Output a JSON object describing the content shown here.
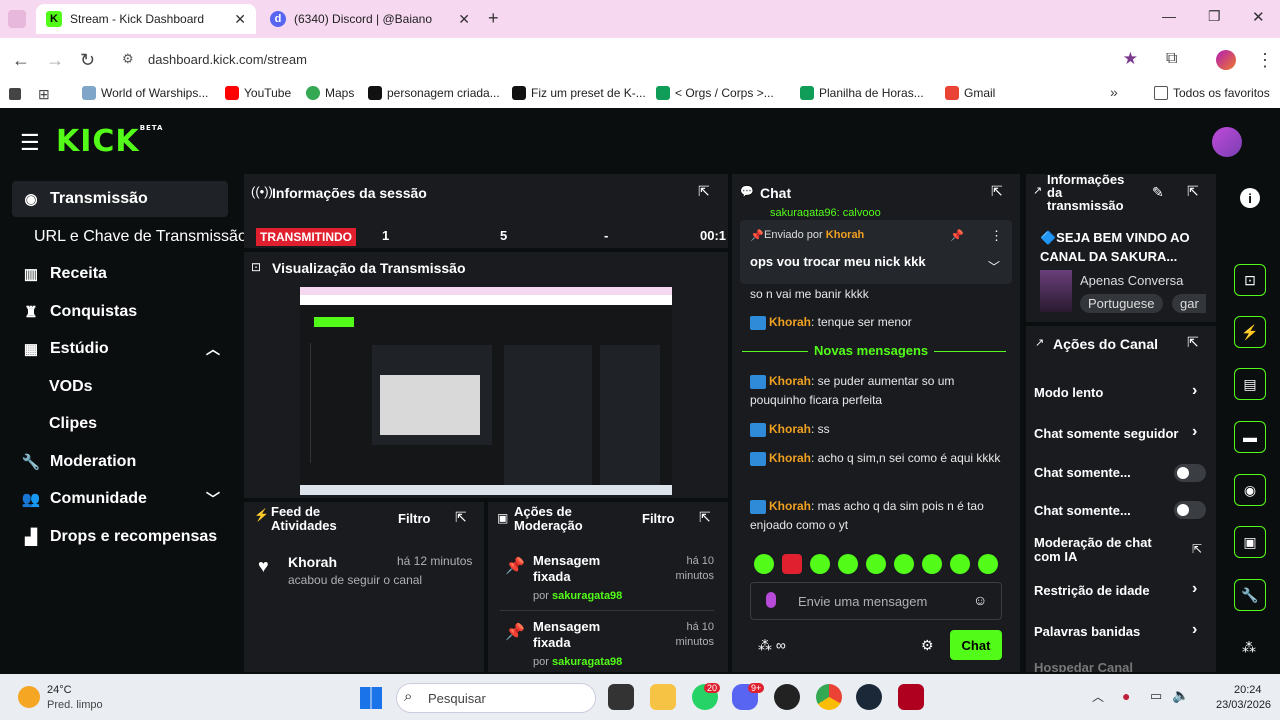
{
  "browser": {
    "tabs": [
      {
        "title": "Stream - Kick Dashboard"
      },
      {
        "title": "(6340) Discord | @Baiano"
      }
    ],
    "url": "dashboard.kick.com/stream",
    "bookmarks": [
      "World of Warships...",
      "YouTube",
      "Maps",
      "personagem criada...",
      "Fiz um preset de K-...",
      "< Orgs / Corps >...",
      "Planilha de Horas...",
      "Gmail"
    ],
    "all_bookmarks": "Todos os favoritos"
  },
  "app": {
    "logo": "KICK",
    "logo_beta": "BETA",
    "sidebar": [
      {
        "label": "Transmissão",
        "icon": "broadcast-icon"
      },
      {
        "label": "URL e Chave de Transmissão"
      },
      {
        "label": "Receita",
        "icon": "chart-icon"
      },
      {
        "label": "Conquistas",
        "icon": "trophy-icon"
      },
      {
        "label": "Estúdio",
        "icon": "studio-icon"
      },
      {
        "label": "VODs"
      },
      {
        "label": "Clipes"
      },
      {
        "label": "Moderation",
        "icon": "wrench-icon"
      },
      {
        "label": "Comunidade",
        "icon": "people-icon"
      },
      {
        "label": "Drops e recompensas",
        "icon": "gift-icon"
      }
    ],
    "session": {
      "title": "Informações da sessão",
      "status": "TRANSMITINDO",
      "stats": [
        "1",
        "5",
        "-",
        "00:1"
      ]
    },
    "preview_title": "Visualização da Transmissão",
    "feed": {
      "title": "Feed de Atividades",
      "filter": "Filtro",
      "items": [
        {
          "user": "Khorah",
          "time": "há 12 minutos",
          "text": "acabou de seguir o canal"
        }
      ]
    },
    "modactions": {
      "title": "Ações de Moderação",
      "filter": "Filtro",
      "items": [
        {
          "title": "Mensagem fixada",
          "time": "há 10 minutos",
          "by": "por",
          "user": "sakuragata98"
        },
        {
          "title": "Mensagem fixada",
          "time": "há 10 minutos",
          "by": "por",
          "user": "sakuragata98"
        }
      ]
    },
    "chat": {
      "title": "Chat",
      "top_cut": "sakuragata96: calvooo",
      "pinned_label": "Enviado por",
      "pinned_user": "Khorah",
      "pinned_text": "ops vou trocar meu nick kkk",
      "messages": [
        {
          "user": "",
          "text": "so n vai me banir kkkk"
        },
        {
          "user": "Khorah",
          "text": "tenque ser menor"
        },
        {
          "user": "Khorah",
          "text": "se puder aumentar so um pouquinho ficara perfeita"
        },
        {
          "user": "Khorah",
          "text": "ss"
        },
        {
          "user": "Khorah",
          "text": "acho q sim,n sei como é aqui kkkk"
        },
        {
          "user": "Khorah",
          "text": "mas acho q da sim pois n é tao enjoado como o yt"
        }
      ],
      "new_messages": "Novas mensagens",
      "placeholder": "Envie uma mensagem",
      "send": "Chat"
    },
    "info": {
      "title": "Informações da transmissão",
      "stream_title": "🔷SEJA BEM VINDO AO CANAL DA SAKURA...",
      "category": "Apenas Conversa",
      "tags": [
        "Portuguese",
        "gar"
      ]
    },
    "channel_actions": {
      "title": "Ações do Canal",
      "items": [
        {
          "label": "Modo lento",
          "type": "chevron"
        },
        {
          "label": "Chat somente seguidor",
          "type": "chevron"
        },
        {
          "label": "Chat somente...",
          "type": "toggle"
        },
        {
          "label": "Chat somente...",
          "type": "toggle"
        },
        {
          "label": "Moderação de chat com IA",
          "type": "external"
        },
        {
          "label": "Restrição de idade",
          "type": "chevron"
        },
        {
          "label": "Palavras banidas",
          "type": "chevron"
        },
        {
          "label": "Hospedar Canal",
          "type": "none"
        }
      ]
    }
  },
  "taskbar": {
    "temp": "24°C",
    "weather": "Pred. limpo",
    "search": "Pesquisar",
    "badges": [
      "20",
      "9+"
    ],
    "time": "20:24",
    "date": "23/03/2026"
  }
}
